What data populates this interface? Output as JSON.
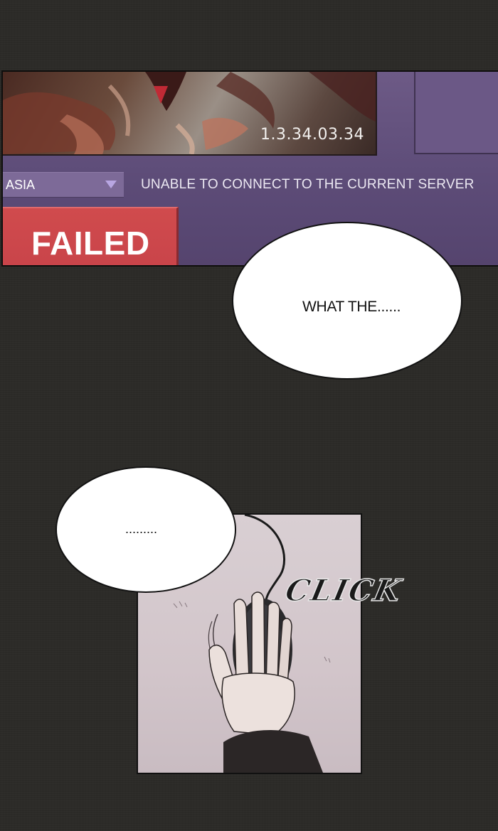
{
  "launcher": {
    "version": "1.3.34.03.34",
    "region": "ASIA",
    "region_icon": "dropdown-triangle-icon",
    "error_message": "UNABLE TO CONNECT TO THE CURRENT SERVER",
    "status_button": "FAILED",
    "colors": {
      "background": "#5e4d7a",
      "select": "#7d6a98",
      "accent_arrow": "#b8a6e2",
      "failed": "#cc474b"
    }
  },
  "dialogue": [
    {
      "text": "WHAT THE......"
    },
    {
      "text": "........."
    }
  ],
  "sound_effect": "CLICK"
}
